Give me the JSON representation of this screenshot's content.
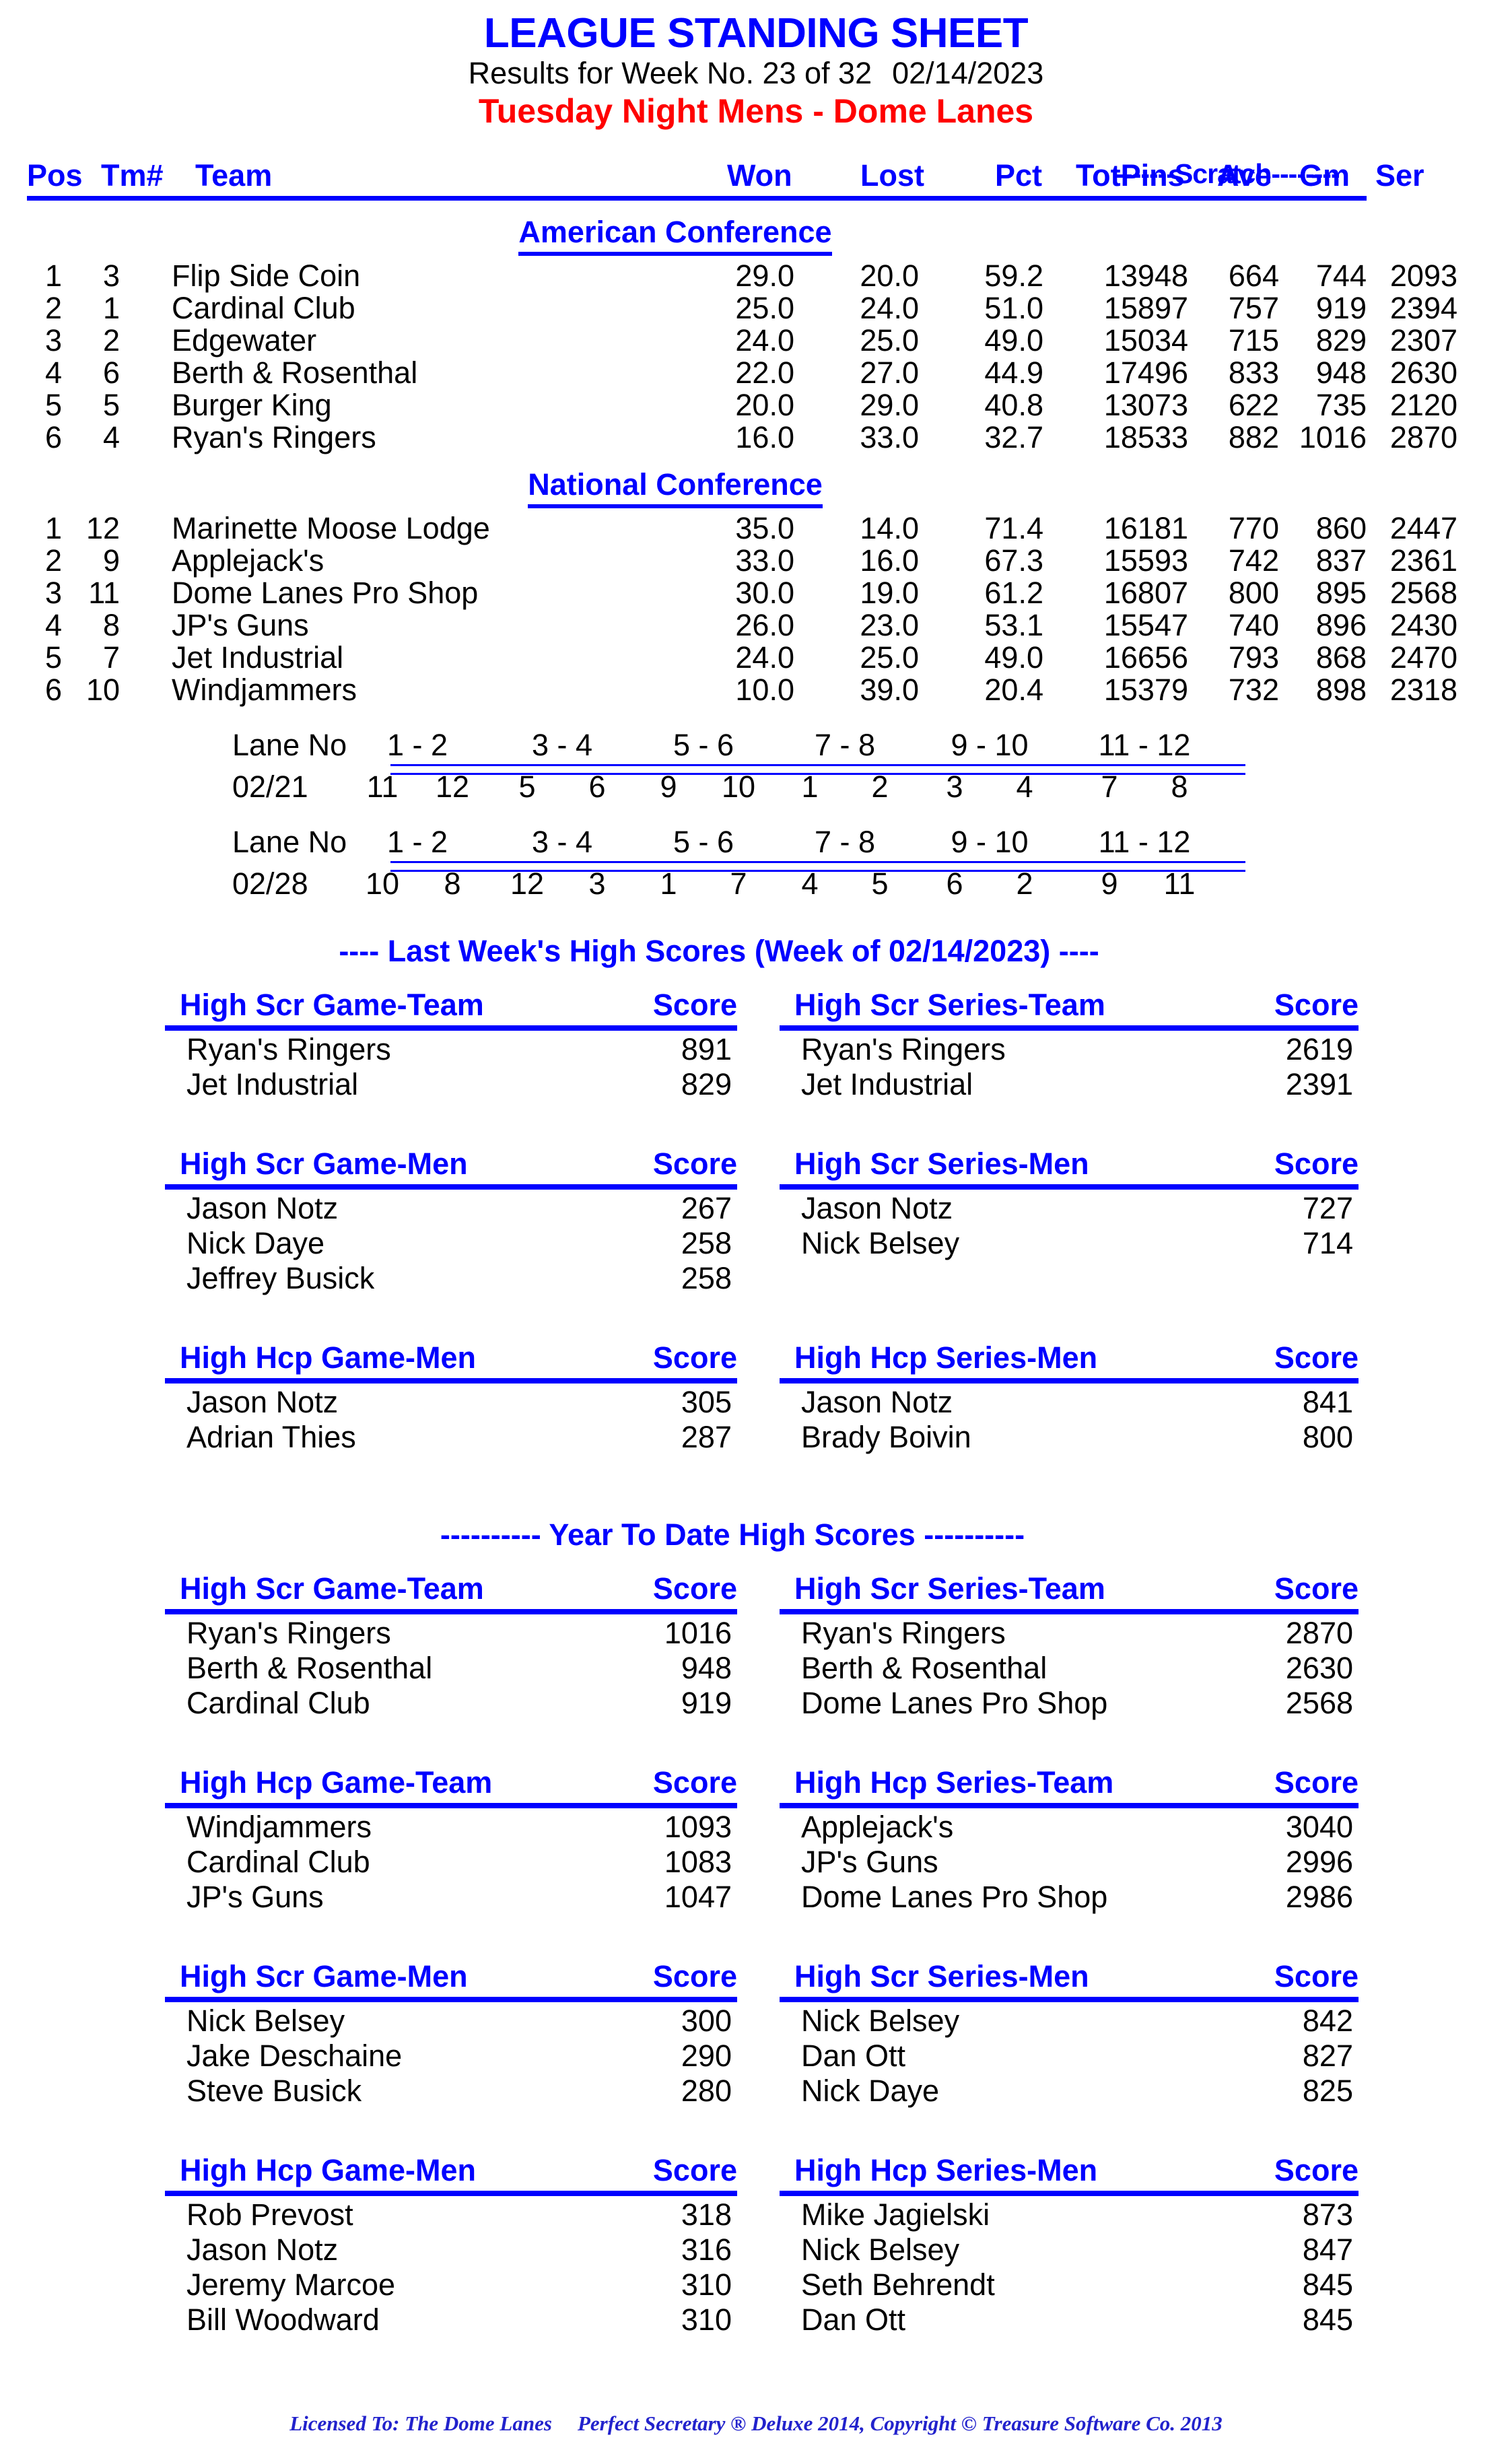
{
  "header": {
    "title": "LEAGUE STANDING SHEET",
    "results_line": "Results for Week No. 23 of 32",
    "results_date": "02/14/2023",
    "league_line": "Tuesday Night Mens - Dome Lanes",
    "title_color": "#0000ff",
    "league_color": "#ff0000"
  },
  "standings": {
    "scratch_label": "-------Scratch--------",
    "columns": {
      "pos": "Pos",
      "tm": "Tm#",
      "team": "Team",
      "won": "Won",
      "lost": "Lost",
      "pct": "Pct",
      "totpins": "TotPins",
      "ave": "Ave",
      "gm": "Gm",
      "ser": "Ser"
    },
    "conferences": [
      {
        "name": "American Conference",
        "rows": [
          {
            "pos": "1",
            "tm": "3",
            "team": "Flip Side Coin",
            "won": "29.0",
            "lost": "20.0",
            "pct": "59.2",
            "totpins": "13948",
            "ave": "664",
            "gm": "744",
            "ser": "2093"
          },
          {
            "pos": "2",
            "tm": "1",
            "team": "Cardinal Club",
            "won": "25.0",
            "lost": "24.0",
            "pct": "51.0",
            "totpins": "15897",
            "ave": "757",
            "gm": "919",
            "ser": "2394"
          },
          {
            "pos": "3",
            "tm": "2",
            "team": "Edgewater",
            "won": "24.0",
            "lost": "25.0",
            "pct": "49.0",
            "totpins": "15034",
            "ave": "715",
            "gm": "829",
            "ser": "2307"
          },
          {
            "pos": "4",
            "tm": "6",
            "team": "Berth & Rosenthal",
            "won": "22.0",
            "lost": "27.0",
            "pct": "44.9",
            "totpins": "17496",
            "ave": "833",
            "gm": "948",
            "ser": "2630"
          },
          {
            "pos": "5",
            "tm": "5",
            "team": "Burger King",
            "won": "20.0",
            "lost": "29.0",
            "pct": "40.8",
            "totpins": "13073",
            "ave": "622",
            "gm": "735",
            "ser": "2120"
          },
          {
            "pos": "6",
            "tm": "4",
            "team": "Ryan's Ringers",
            "won": "16.0",
            "lost": "33.0",
            "pct": "32.7",
            "totpins": "18533",
            "ave": "882",
            "gm": "1016",
            "ser": "2870"
          }
        ]
      },
      {
        "name": "National Conference",
        "rows": [
          {
            "pos": "1",
            "tm": "12",
            "team": "Marinette Moose Lodge",
            "won": "35.0",
            "lost": "14.0",
            "pct": "71.4",
            "totpins": "16181",
            "ave": "770",
            "gm": "860",
            "ser": "2447"
          },
          {
            "pos": "2",
            "tm": "9",
            "team": "Applejack's",
            "won": "33.0",
            "lost": "16.0",
            "pct": "67.3",
            "totpins": "15593",
            "ave": "742",
            "gm": "837",
            "ser": "2361"
          },
          {
            "pos": "3",
            "tm": "11",
            "team": "Dome Lanes Pro Shop",
            "won": "30.0",
            "lost": "19.0",
            "pct": "61.2",
            "totpins": "16807",
            "ave": "800",
            "gm": "895",
            "ser": "2568"
          },
          {
            "pos": "4",
            "tm": "8",
            "team": "JP's Guns",
            "won": "26.0",
            "lost": "23.0",
            "pct": "53.1",
            "totpins": "15547",
            "ave": "740",
            "gm": "896",
            "ser": "2430"
          },
          {
            "pos": "5",
            "tm": "7",
            "team": "Jet Industrial",
            "won": "24.0",
            "lost": "25.0",
            "pct": "49.0",
            "totpins": "16656",
            "ave": "793",
            "gm": "868",
            "ser": "2470"
          },
          {
            "pos": "6",
            "tm": "10",
            "team": "Windjammers",
            "won": "10.0",
            "lost": "39.0",
            "pct": "20.4",
            "totpins": "15379",
            "ave": "732",
            "gm": "898",
            "ser": "2318"
          }
        ]
      }
    ]
  },
  "lane_schedule": {
    "label": "Lane No",
    "lane_pairs": [
      "1 - 2",
      "3 - 4",
      "5 - 6",
      "7 - 8",
      "9 - 10",
      "11 - 12"
    ],
    "weeks": [
      {
        "date": "02/21",
        "assignments": [
          [
            "11",
            "12"
          ],
          [
            "5",
            "6"
          ],
          [
            "9",
            "10"
          ],
          [
            "1",
            "2"
          ],
          [
            "3",
            "4"
          ],
          [
            "7",
            "8"
          ]
        ]
      },
      {
        "date": "02/28",
        "assignments": [
          [
            "10",
            "8"
          ],
          [
            "12",
            "3"
          ],
          [
            "1",
            "7"
          ],
          [
            "4",
            "5"
          ],
          [
            "6",
            "2"
          ],
          [
            "9",
            "11"
          ]
        ]
      }
    ]
  },
  "last_week": {
    "banner": "----  Last Week's High Scores   (Week of 02/14/2023)  ----",
    "score_col_label": "Score",
    "blocks": [
      {
        "left": {
          "title": "High Scr Game-Team",
          "rows": [
            {
              "name": "Ryan's Ringers",
              "score": "891"
            },
            {
              "name": "Jet Industrial",
              "score": "829"
            }
          ]
        },
        "right": {
          "title": "High Scr Series-Team",
          "rows": [
            {
              "name": "Ryan's Ringers",
              "score": "2619"
            },
            {
              "name": "Jet Industrial",
              "score": "2391"
            }
          ]
        }
      },
      {
        "left": {
          "title": "High Scr Game-Men",
          "rows": [
            {
              "name": "Jason Notz",
              "score": "267"
            },
            {
              "name": "Nick Daye",
              "score": "258"
            },
            {
              "name": "Jeffrey Busick",
              "score": "258"
            }
          ]
        },
        "right": {
          "title": "High Scr Series-Men",
          "rows": [
            {
              "name": "Jason Notz",
              "score": "727"
            },
            {
              "name": "Nick Belsey",
              "score": "714"
            }
          ]
        }
      },
      {
        "left": {
          "title": "High Hcp Game-Men",
          "rows": [
            {
              "name": "Jason Notz",
              "score": "305"
            },
            {
              "name": "Adrian Thies",
              "score": "287"
            }
          ]
        },
        "right": {
          "title": "High Hcp Series-Men",
          "rows": [
            {
              "name": "Jason Notz",
              "score": "841"
            },
            {
              "name": "Brady Boivin",
              "score": "800"
            }
          ]
        }
      }
    ]
  },
  "year_to_date": {
    "banner": "---------- Year To Date High Scores ----------",
    "score_col_label": "Score",
    "blocks": [
      {
        "left": {
          "title": "High Scr Game-Team",
          "rows": [
            {
              "name": "Ryan's Ringers",
              "score": "1016"
            },
            {
              "name": "Berth & Rosenthal",
              "score": "948"
            },
            {
              "name": "Cardinal Club",
              "score": "919"
            }
          ]
        },
        "right": {
          "title": "High Scr Series-Team",
          "rows": [
            {
              "name": "Ryan's Ringers",
              "score": "2870"
            },
            {
              "name": "Berth & Rosenthal",
              "score": "2630"
            },
            {
              "name": "Dome Lanes Pro Shop",
              "score": "2568"
            }
          ]
        }
      },
      {
        "left": {
          "title": "High Hcp Game-Team",
          "rows": [
            {
              "name": "Windjammers",
              "score": "1093"
            },
            {
              "name": "Cardinal Club",
              "score": "1083"
            },
            {
              "name": "JP's Guns",
              "score": "1047"
            }
          ]
        },
        "right": {
          "title": "High Hcp Series-Team",
          "rows": [
            {
              "name": "Applejack's",
              "score": "3040"
            },
            {
              "name": "JP's Guns",
              "score": "2996"
            },
            {
              "name": "Dome Lanes Pro Shop",
              "score": "2986"
            }
          ]
        }
      },
      {
        "left": {
          "title": "High Scr Game-Men",
          "rows": [
            {
              "name": "Nick Belsey",
              "score": "300"
            },
            {
              "name": "Jake Deschaine",
              "score": "290"
            },
            {
              "name": "Steve Busick",
              "score": "280"
            }
          ]
        },
        "right": {
          "title": "High Scr Series-Men",
          "rows": [
            {
              "name": "Nick Belsey",
              "score": "842"
            },
            {
              "name": "Dan Ott",
              "score": "827"
            },
            {
              "name": "Nick Daye",
              "score": "825"
            }
          ]
        }
      },
      {
        "left": {
          "title": "High Hcp Game-Men",
          "rows": [
            {
              "name": "Rob Prevost",
              "score": "318"
            },
            {
              "name": "Jason Notz",
              "score": "316"
            },
            {
              "name": "Jeremy Marcoe",
              "score": "310"
            },
            {
              "name": "Bill Woodward",
              "score": "310"
            }
          ]
        },
        "right": {
          "title": "High Hcp Series-Men",
          "rows": [
            {
              "name": "Mike Jagielski",
              "score": "873"
            },
            {
              "name": "Nick Belsey",
              "score": "847"
            },
            {
              "name": "Seth Behrendt",
              "score": "845"
            },
            {
              "name": "Dan Ott",
              "score": "845"
            }
          ]
        }
      }
    ]
  },
  "footer": {
    "licensed_to": "Licensed To: The Dome Lanes",
    "software": "Perfect Secretary ® Deluxe  2014, Copyright © Treasure Software Co. 2013"
  }
}
